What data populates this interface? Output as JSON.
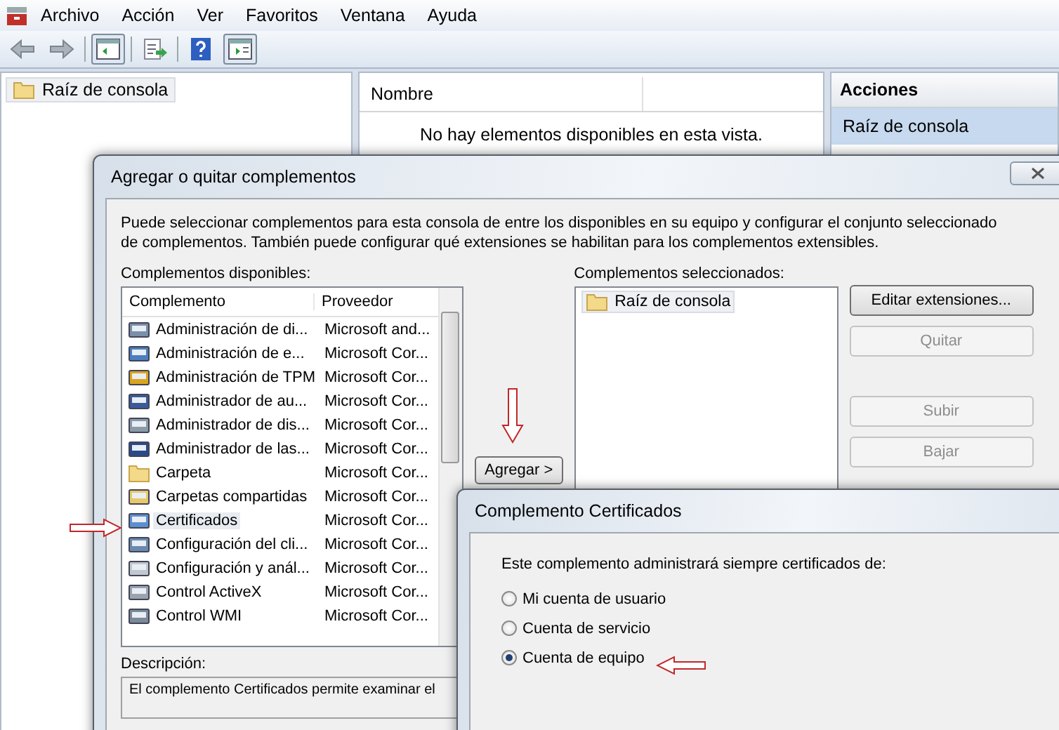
{
  "menu": [
    "Archivo",
    "Acción",
    "Ver",
    "Favoritos",
    "Ventana",
    "Ayuda"
  ],
  "tree": {
    "items": [
      {
        "label": "Raíz de consola",
        "selected": true
      }
    ]
  },
  "results": {
    "columns": [
      "Nombre"
    ],
    "empty_message": "No hay elementos disponibles en esta vista."
  },
  "actions": {
    "title": "Acciones",
    "items": [
      {
        "label": "Raíz de consola",
        "selected": true
      }
    ]
  },
  "add_remove_dialog": {
    "title": "Agregar o quitar complementos",
    "intro": "Puede seleccionar complementos para esta consola de entre los disponibles en su equipo y configurar el conjunto seleccionado de complementos. También puede configurar qué extensiones se habilitan para los complementos extensibles.",
    "available_label": "Complementos disponibles:",
    "available_columns": [
      "Complemento",
      "Proveedor"
    ],
    "available": [
      {
        "name": "Administración de di...",
        "vendor": "Microsoft and...",
        "selected": false
      },
      {
        "name": "Administración de e...",
        "vendor": "Microsoft Cor...",
        "selected": false
      },
      {
        "name": "Administración de TPM",
        "vendor": "Microsoft Cor...",
        "selected": false
      },
      {
        "name": "Administrador de au...",
        "vendor": "Microsoft Cor...",
        "selected": false
      },
      {
        "name": "Administrador de dis...",
        "vendor": "Microsoft Cor...",
        "selected": false
      },
      {
        "name": "Administrador de las...",
        "vendor": "Microsoft Cor...",
        "selected": false
      },
      {
        "name": "Carpeta",
        "vendor": "Microsoft Cor...",
        "selected": false
      },
      {
        "name": "Carpetas compartidas",
        "vendor": "Microsoft Cor...",
        "selected": false
      },
      {
        "name": "Certificados",
        "vendor": "Microsoft Cor...",
        "selected": true
      },
      {
        "name": "Configuración del cli...",
        "vendor": "Microsoft Cor...",
        "selected": false
      },
      {
        "name": "Configuración y anál...",
        "vendor": "Microsoft Cor...",
        "selected": false
      },
      {
        "name": "Control ActiveX",
        "vendor": "Microsoft Cor...",
        "selected": false
      },
      {
        "name": "Control WMI",
        "vendor": "Microsoft Cor...",
        "selected": false
      }
    ],
    "add_button": "Agregar >",
    "selected_label": "Complementos seleccionados:",
    "selected_items": [
      {
        "label": "Raíz de consola",
        "selected": true
      }
    ],
    "buttons": [
      {
        "label": "Editar extensiones...",
        "disabled": false
      },
      {
        "label": "Quitar",
        "disabled": true
      },
      {
        "label": "Subir",
        "disabled": true
      },
      {
        "label": "Bajar",
        "disabled": true
      }
    ],
    "description_label": "Descripción:",
    "description": "El complemento Certificados permite examinar el"
  },
  "certificates_dialog": {
    "title": "Complemento Certificados",
    "prompt": "Este complemento administrará siempre certificados de:",
    "options": [
      {
        "label": "Mi cuenta de usuario",
        "selected": false
      },
      {
        "label": "Cuenta de servicio",
        "selected": false
      },
      {
        "label": "Cuenta de equipo",
        "selected": true
      }
    ]
  }
}
